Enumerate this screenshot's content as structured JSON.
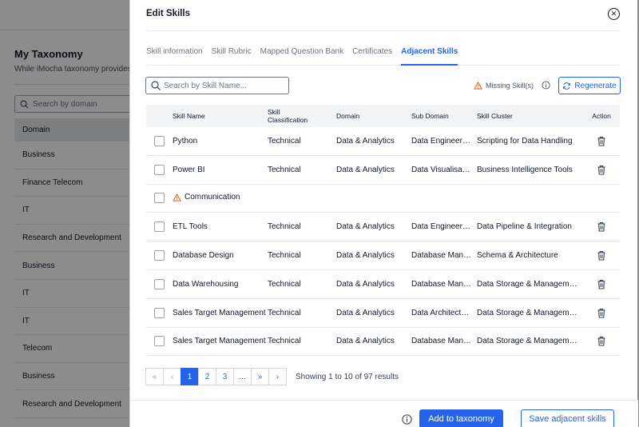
{
  "background": {
    "title": "My Taxonomy",
    "description": "While iMocha taxonomy provides",
    "search_placeholder": "Search by domain",
    "header": "Domain",
    "rows": [
      "Business",
      "Finance Telecom",
      "IT",
      "Research and Development",
      "Business",
      "IT",
      "IT",
      "Telecom",
      "Business",
      "Research and Development"
    ]
  },
  "modal": {
    "title": "Edit Skills",
    "close_icon": "close-circle-icon",
    "tabs": [
      {
        "label": "Skill information",
        "active": false
      },
      {
        "label": "Skill Rubric",
        "active": false
      },
      {
        "label": "Mapped Question Bank",
        "active": false
      },
      {
        "label": "Certificates",
        "active": false
      },
      {
        "label": "Adjacent Skills",
        "active": true
      }
    ],
    "search_placeholder": "Search by Skill Name...",
    "missing_label": "Missing Skill(s)",
    "regenerate_label": "Regenerate",
    "accent_color": "#2563eb",
    "warning_color": "#ea580c"
  },
  "table": {
    "headers": {
      "name": "Skill Name",
      "classification": "Skill Classification",
      "domain": "Domain",
      "sub_domain": "Sub Domain",
      "cluster": "Skill Cluster",
      "action": "Action"
    },
    "rows": [
      {
        "name": "Python",
        "classification": "Technical",
        "domain": "Data & Analytics",
        "sub_domain": "Data Engineering",
        "cluster": "Scripting for Data Handling",
        "missing": false
      },
      {
        "name": "Power BI",
        "classification": "Technical",
        "domain": "Data & Analytics",
        "sub_domain": "Data Visualisation",
        "cluster": "Business Intelligence Tools",
        "missing": false
      },
      {
        "name": "Communication",
        "classification": "",
        "domain": "",
        "sub_domain": "",
        "cluster": "",
        "missing": true
      },
      {
        "name": "ETL Tools",
        "classification": "Technical",
        "domain": "Data & Analytics",
        "sub_domain": "Data Engineering",
        "cluster": "Data Pipeline & Integration",
        "missing": false
      },
      {
        "name": "Database Design",
        "classification": "Technical",
        "domain": "Data & Analytics",
        "sub_domain": "Database Management",
        "cluster": "Schema & Architecture",
        "missing": false
      },
      {
        "name": "Data Warehousing",
        "classification": "Technical",
        "domain": "Data & Analytics",
        "sub_domain": "Database Management",
        "cluster": "Data Storage & Management",
        "missing": false
      },
      {
        "name": "Sales Target Management",
        "classification": "Technical",
        "domain": "Data & Analytics",
        "sub_domain": "Data Architecture",
        "cluster": "Data Storage & Management",
        "missing": false
      },
      {
        "name": "Sales Target Management",
        "classification": "Technical",
        "domain": "Data & Analytics",
        "sub_domain": "Database Management",
        "cluster": "Data Storage & Management",
        "missing": false
      }
    ]
  },
  "pagination": {
    "first": "«",
    "prev": "‹",
    "pages": [
      "1",
      "2",
      "3",
      "..."
    ],
    "active_page": "1",
    "next_group": "»",
    "next": "›",
    "info": "Showing 1 to 10 of 97 results"
  },
  "footer": {
    "add_label": "Add to taxonomy",
    "save_label": "Save adjacent skills"
  }
}
